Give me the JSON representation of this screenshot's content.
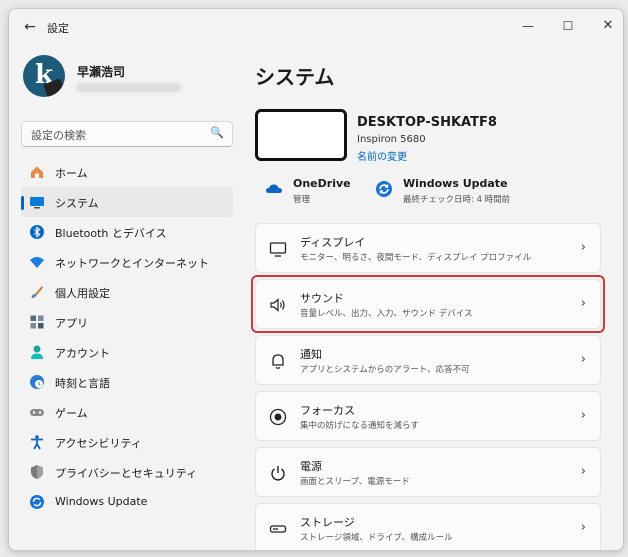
{
  "window": {
    "title": "設定",
    "back_icon": "arrow-left-icon",
    "minimize_glyph": "—",
    "maximize_glyph": "☐",
    "close_glyph": "✕"
  },
  "user": {
    "name": "早瀬浩司",
    "avatar_letter": "k"
  },
  "search": {
    "placeholder": "設定の検索",
    "icon": "🔍"
  },
  "nav": [
    {
      "id": "home",
      "label": "ホーム",
      "icon": "home-icon",
      "color": "#e07a3a",
      "active": false
    },
    {
      "id": "system",
      "label": "システム",
      "icon": "monitor-icon",
      "color": "#0078d4",
      "active": true
    },
    {
      "id": "bluetooth",
      "label": "Bluetooth とデバイス",
      "icon": "bluetooth-icon",
      "color": "#0078d4",
      "active": false
    },
    {
      "id": "network",
      "label": "ネットワークとインターネット",
      "icon": "wifi-icon",
      "color": "#0078d4",
      "active": false
    },
    {
      "id": "personalize",
      "label": "個人用設定",
      "icon": "brush-icon",
      "color": "#c57a2c",
      "active": false
    },
    {
      "id": "apps",
      "label": "アプリ",
      "icon": "apps-icon",
      "color": "#4a5a6a",
      "active": false
    },
    {
      "id": "accounts",
      "label": "アカウント",
      "icon": "person-icon",
      "color": "#1ba39a",
      "active": false
    },
    {
      "id": "time",
      "label": "時刻と言語",
      "icon": "clock-globe-icon",
      "color": "#2b7cd3",
      "active": false
    },
    {
      "id": "gaming",
      "label": "ゲーム",
      "icon": "gamepad-icon",
      "color": "#6b6b6b",
      "active": false
    },
    {
      "id": "accessibility",
      "label": "アクセシビリティ",
      "icon": "accessibility-icon",
      "color": "#0078d4",
      "active": false
    },
    {
      "id": "privacy",
      "label": "プライバシーとセキュリティ",
      "icon": "shield-icon",
      "color": "#6b6b6b",
      "active": false
    },
    {
      "id": "update",
      "label": "Windows Update",
      "icon": "sync-icon",
      "color": "#0078d4",
      "active": false
    }
  ],
  "main": {
    "title": "システム",
    "device": {
      "name": "DESKTOP-SHKATF8",
      "model": "Inspiron 5680",
      "rename_link": "名前の変更"
    },
    "quick": [
      {
        "title": "OneDrive",
        "subtitle": "管理",
        "icon": "cloud-icon"
      },
      {
        "title": "Windows Update",
        "subtitle": "最終チェック日時: 4 時間前",
        "icon": "sync-icon"
      }
    ],
    "cards": [
      {
        "title": "ディスプレイ",
        "subtitle": "モニター、明るさ、夜間モード、ディスプレイ プロファイル",
        "icon": "display-icon",
        "highlight": false
      },
      {
        "title": "サウンド",
        "subtitle": "音量レベル、出力、入力、サウンド デバイス",
        "icon": "speaker-icon",
        "highlight": true
      },
      {
        "title": "通知",
        "subtitle": "アプリとシステムからのアラート、応答不可",
        "icon": "bell-icon",
        "highlight": false
      },
      {
        "title": "フォーカス",
        "subtitle": "集中の妨げになる通知を減らす",
        "icon": "focus-icon",
        "highlight": false
      },
      {
        "title": "電源",
        "subtitle": "画面とスリープ、電源モード",
        "icon": "power-icon",
        "highlight": false
      },
      {
        "title": "ストレージ",
        "subtitle": "ストレージ領域、ドライブ、構成ルール",
        "icon": "storage-icon",
        "highlight": false
      }
    ],
    "chevron": "›"
  },
  "colors": {
    "accent": "#0067c0",
    "highlight_box": "#d8353a"
  }
}
